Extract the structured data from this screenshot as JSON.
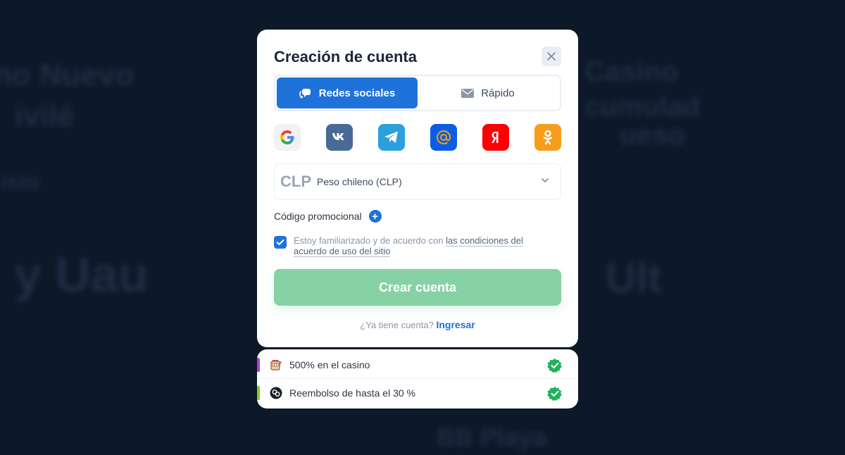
{
  "modal": {
    "title": "Creación de cuenta",
    "tabs": [
      {
        "label": "Redes sociales",
        "icon": "chat-bubble-icon",
        "active": true
      },
      {
        "label": "Rápido",
        "icon": "envelope-icon",
        "active": false
      }
    ],
    "socials": [
      {
        "name": "Google",
        "color": "#ffffff"
      },
      {
        "name": "VK",
        "color": "#4a6a96"
      },
      {
        "name": "Telegram",
        "color": "#2aa1da"
      },
      {
        "name": "Mail.ru",
        "color": "#0b5de6"
      },
      {
        "name": "Yandex",
        "color": "#ff0000"
      },
      {
        "name": "Odnoklassniki",
        "color": "#f79d1c"
      }
    ],
    "currency": {
      "code": "CLP",
      "name": "Peso chileno (CLP)"
    },
    "promo_label": "Código promocional",
    "agree": {
      "checked": true,
      "text": "Estoy familiarizado y de acuerdo con ",
      "link": "las condiciones del acuerdo de uso del sitio"
    },
    "create_button": "Crear cuenta",
    "login_prompt": "¿Ya tiene cuenta?",
    "login_link": "Ingresar"
  },
  "bonuses": [
    {
      "text": "500% en el casino",
      "accent": "#b43cd8",
      "icon": "slot-machine-icon"
    },
    {
      "text": "Reembolso de hasta el 30 %",
      "accent": "#8cc820",
      "icon": "cashback-coin-icon"
    }
  ],
  "colors": {
    "primary": "#1f72d9",
    "create_button": "#86d2a5",
    "check_green": "#21b35a",
    "background": "#0d1829"
  }
}
